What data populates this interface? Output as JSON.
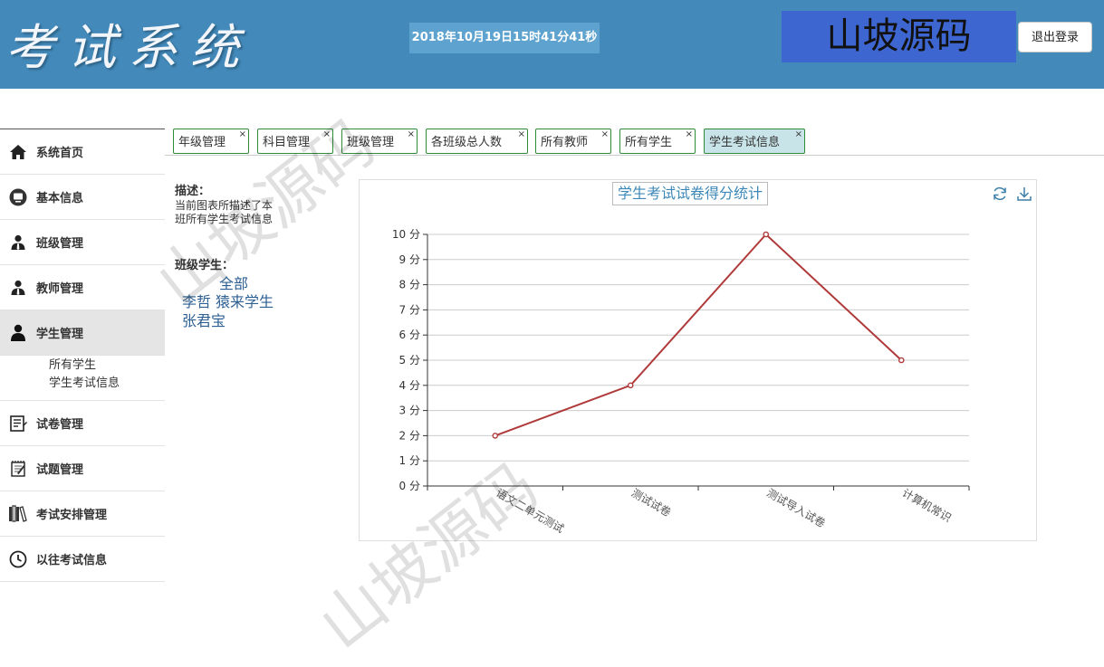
{
  "header": {
    "logo": "考试系统",
    "datetime": "2018年10月19日15时41分41秒",
    "brand": "山坡源码",
    "logout_label": "退出登录"
  },
  "sidebar": {
    "items": [
      {
        "label": "系统首页",
        "icon": "home-icon"
      },
      {
        "label": "基本信息",
        "icon": "monitor-icon"
      },
      {
        "label": "班级管理",
        "icon": "user-tie-icon"
      },
      {
        "label": "教师管理",
        "icon": "user-tie-icon"
      },
      {
        "label": "学生管理",
        "icon": "user-icon",
        "active": true
      },
      {
        "label": "试卷管理",
        "icon": "document-icon"
      },
      {
        "label": "试题管理",
        "icon": "notepad-icon"
      },
      {
        "label": "考试安排管理",
        "icon": "books-icon"
      },
      {
        "label": "以往考试信息",
        "icon": "clock-icon"
      }
    ],
    "subitems": [
      "所有学生",
      "学生考试信息"
    ]
  },
  "tabs": [
    {
      "label": "年级管理"
    },
    {
      "label": "科目管理"
    },
    {
      "label": "班级管理"
    },
    {
      "label": "各班级总人数"
    },
    {
      "label": "所有教师"
    },
    {
      "label": "所有学生"
    },
    {
      "label": "学生考试信息",
      "active": true
    }
  ],
  "tab_close": "×",
  "desc": {
    "heading": "描述：",
    "text": "当前图表所描述了本班所有学生考试信息"
  },
  "students": {
    "heading": "班级学生：",
    "links": [
      "全部",
      "李哲",
      "猿来学生",
      "张君宝"
    ]
  },
  "chart_data": {
    "type": "line",
    "title": "学生考试试卷得分统计",
    "categories": [
      "语文二单元测试",
      "测试试卷",
      "测试导入试卷",
      "计算机常识"
    ],
    "series": [
      {
        "values": [
          2,
          4,
          10,
          5
        ],
        "color": "#b03a3a"
      }
    ],
    "ylim": [
      0,
      10
    ],
    "yticks": [
      "0 分",
      "1 分",
      "2 分",
      "3 分",
      "4 分",
      "5 分",
      "6 分",
      "7 分",
      "8 分",
      "9 分",
      "10 分"
    ],
    "grid": true,
    "toolbox": [
      "refresh-icon",
      "download-icon"
    ]
  },
  "watermark": "山坡源码"
}
